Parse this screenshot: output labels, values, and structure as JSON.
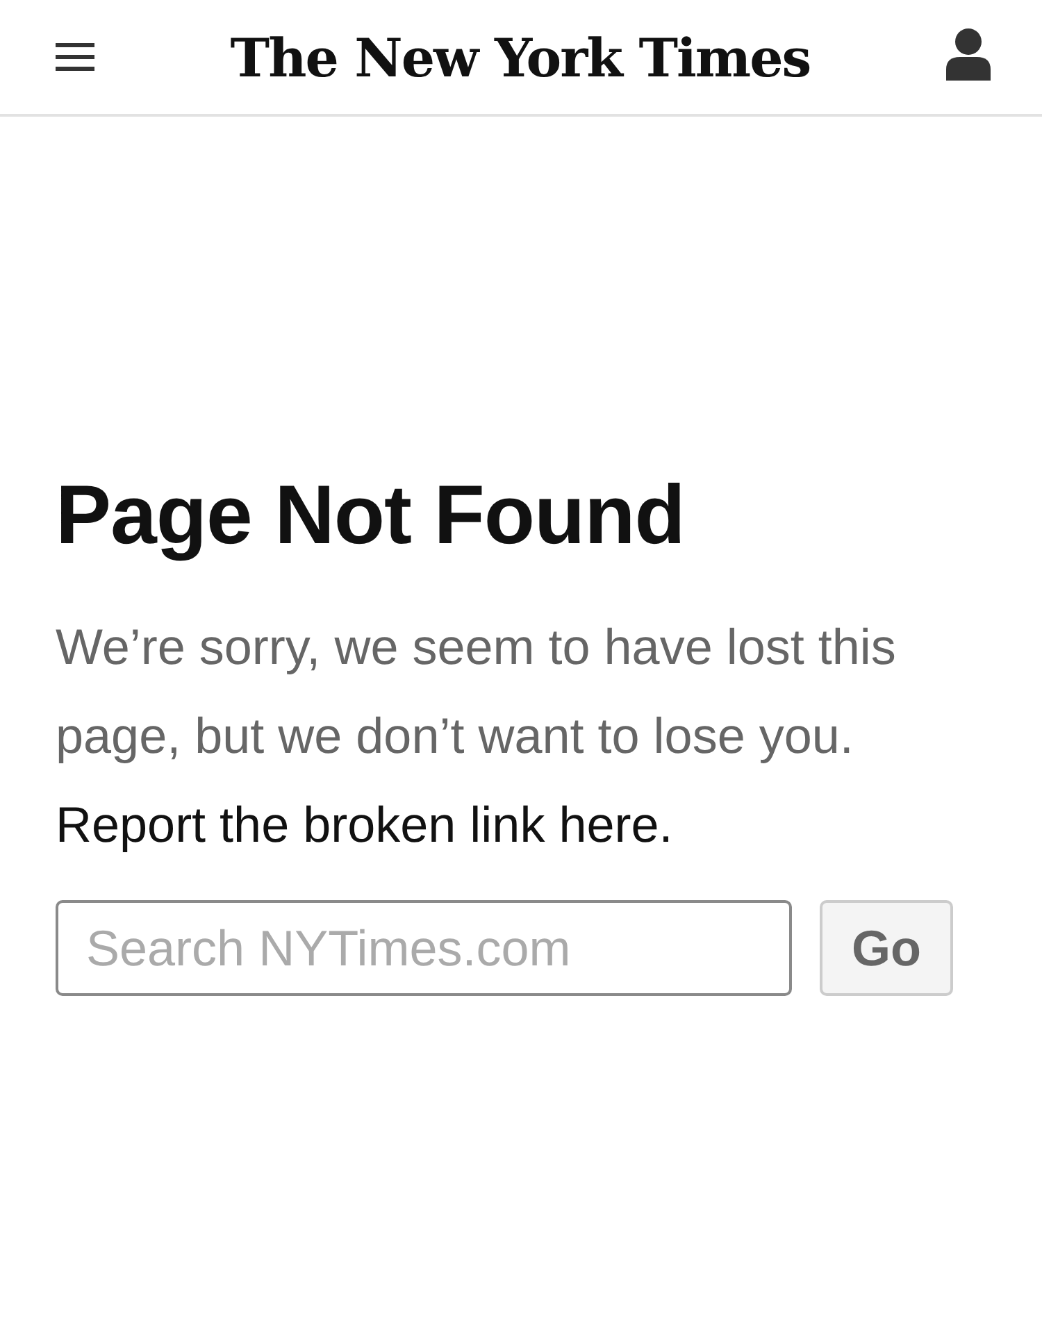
{
  "header": {
    "logo": "The New York Times"
  },
  "error": {
    "title": "Page Not Found",
    "message": "We’re sorry, we seem to have lost this page, but we don’t want to lose you.",
    "link": "Report the broken link here."
  },
  "search": {
    "placeholder": "Search NYTimes.com",
    "button": "Go"
  }
}
